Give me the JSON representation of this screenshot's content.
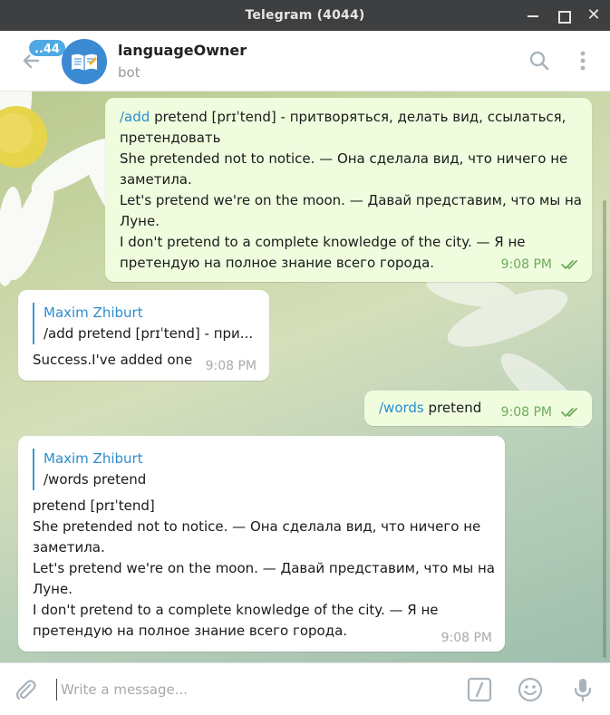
{
  "window": {
    "title": "Telegram (4044)"
  },
  "header": {
    "unread_badge": "..44",
    "chat_name": "languageOwner",
    "chat_status": "bot"
  },
  "messages": [
    {
      "direction": "outgoing",
      "command": "/add",
      "lines": [
        " pretend [prɪˈtend] - притворяться, делать вид, ссылаться,",
        "претендовать",
        "She pretended not to notice. — Она сделала вид, что ничего не",
        "заметила.",
        "Let's pretend we're on the moon. — Давай представим, что мы на",
        "Луне.",
        "I don't pretend to a complete knowledge of the city. — Я не",
        "претендую на полное знание всего города."
      ],
      "time": "9:08 PM"
    },
    {
      "direction": "incoming",
      "reply_name": "Maxim Zhiburt",
      "reply_text": "/add pretend [prɪˈtend] - при...",
      "text": "Success.I've added one",
      "time": "9:08 PM"
    },
    {
      "direction": "outgoing",
      "command": "/words",
      "text": " pretend",
      "time": "9:08 PM"
    },
    {
      "direction": "incoming",
      "reply_name": "Maxim Zhiburt",
      "reply_text": "/words pretend",
      "lines": [
        "pretend [prɪˈtend]",
        "She pretended not to notice. — Она сделала вид, что ничего не",
        "заметила.",
        "Let's pretend we're on the moon. — Давай представим, что мы на",
        "Луне.",
        "I don't pretend to a complete knowledge of the city. — Я не",
        "претендую на полное знание всего города."
      ],
      "time": "9:08 PM"
    }
  ],
  "composer": {
    "placeholder": "Write a message..."
  },
  "colors": {
    "titlebar": "#3e3f40",
    "accent": "#2d8ccf",
    "outgoing_bubble": "#effdde",
    "read_check": "#6cab5a"
  },
  "icons": [
    "back-arrow-icon",
    "search-icon",
    "more-vertical-icon",
    "paperclip-icon",
    "bot-command-icon",
    "emoji-icon",
    "microphone-icon",
    "double-check-icon",
    "book-avatar-icon"
  ]
}
